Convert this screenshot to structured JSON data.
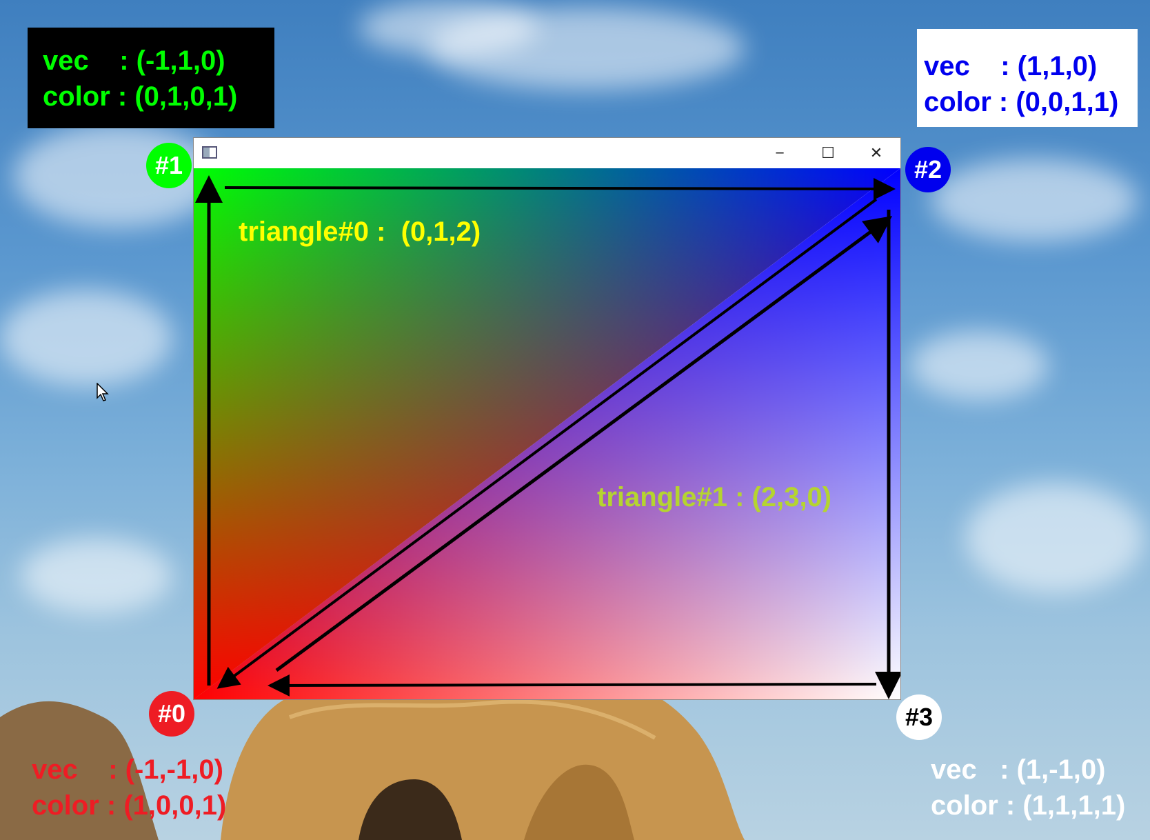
{
  "vertices": [
    {
      "badge": "#0",
      "vec_key": "vec    ",
      "vec_value": ": (-1,-1,0)",
      "color_key": "color ",
      "color_value": ": (1,0,0,1)",
      "fill": "#ff0000",
      "text_color": "#ee1c24"
    },
    {
      "badge": "#1",
      "vec_key": "vec    ",
      "vec_value": ": (-1,1,0)",
      "color_key": "color ",
      "color_value": ": (0,1,0,1)",
      "fill": "#00ff00",
      "text_color": "#00ff00"
    },
    {
      "badge": "#2",
      "vec_key": "vec    ",
      "vec_value": ": (1,1,0)",
      "color_key": "color ",
      "color_value": ": (0,0,1,1)",
      "fill": "#0000ff",
      "text_color": "#0000ee"
    },
    {
      "badge": "#3",
      "vec_key": "vec   ",
      "vec_value": ": (1,-1,0)",
      "color_key": "color ",
      "color_value": ": (1,1,1,1)",
      "fill": "#ffffff",
      "text_color": "#ffffff"
    }
  ],
  "triangles": {
    "t0": "triangle#0 :  (0,1,2)",
    "t1": "triangle#1 : (2,3,0)"
  },
  "window": {
    "minimize": "─",
    "maximize": "☐",
    "close": "✕"
  },
  "colors": {
    "triangle0_label": "#ffff00",
    "triangle1_label": "#b5d430"
  }
}
